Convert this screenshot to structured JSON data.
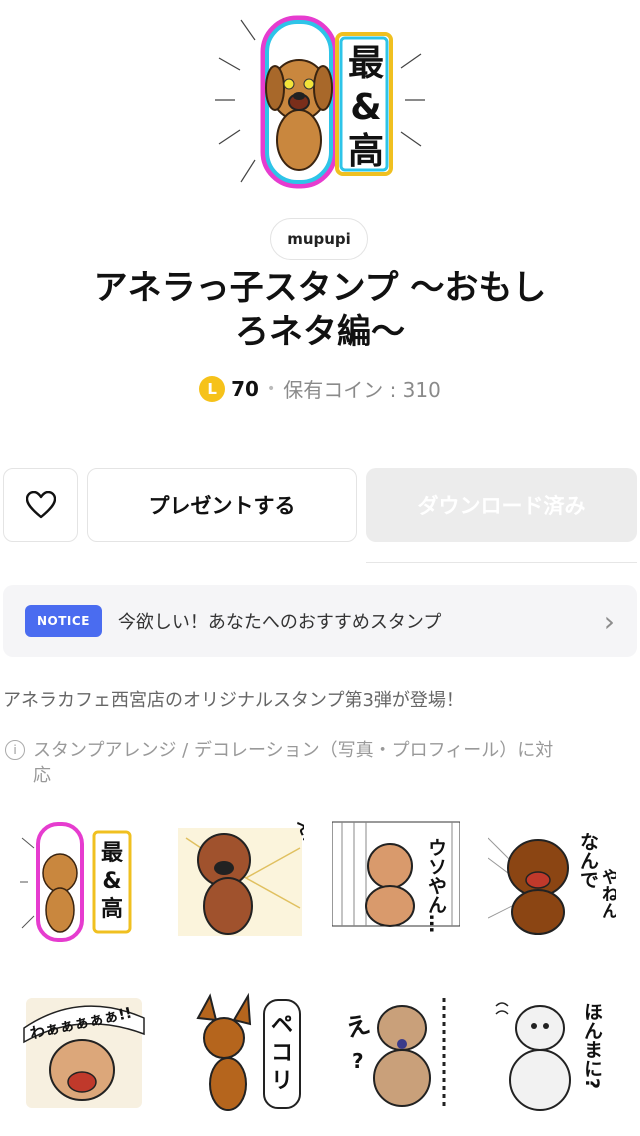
{
  "hero": {
    "icon": "sticker-dog-best-icon",
    "text_line1": "最",
    "text_amp": "&",
    "text_line2": "高"
  },
  "creator": "mupupi",
  "title_line1": "アネラっ子スタンプ 〜おもし",
  "title_line2": "ろネタ編〜",
  "price": {
    "coin_letter": "L",
    "amount": "70",
    "owned_coins": "保有コイン : 310"
  },
  "buttons": {
    "like_icon": "heart-icon",
    "present": "プレゼントする",
    "download": "ダウンロード済み"
  },
  "notice": {
    "badge": "NOTICE",
    "text": "今欲しい！あなたへのおすすめスタンプ"
  },
  "description": "アネラカフェ西宮店のオリジナルスタンプ第3弾が登場！",
  "info": {
    "icon_glyph": "i",
    "text_line1": "スタンプアレンジ / デコレーション（写真・プロフィール）に対",
    "text_line2": "応"
  },
  "stickers": [
    {
      "name": "sticker-saikou",
      "text": "最&高"
    },
    {
      "name": "sticker-eeyan",
      "text": "ええやーん!!"
    },
    {
      "name": "sticker-usoyan",
      "text": "ウソやん…"
    },
    {
      "name": "sticker-nandeyanen",
      "text": "なんでやねん"
    },
    {
      "name": "sticker-waaaa",
      "text": "わぁぁぁぁぁ!!"
    },
    {
      "name": "sticker-pekori",
      "text": "ペコリ"
    },
    {
      "name": "sticker-e",
      "text": "え？"
    },
    {
      "name": "sticker-honmani",
      "text": "ほんまに？"
    }
  ],
  "colors": {
    "accent": "#4a6cf0",
    "coin": "#f6c21a",
    "download_bg": "#ececec"
  }
}
